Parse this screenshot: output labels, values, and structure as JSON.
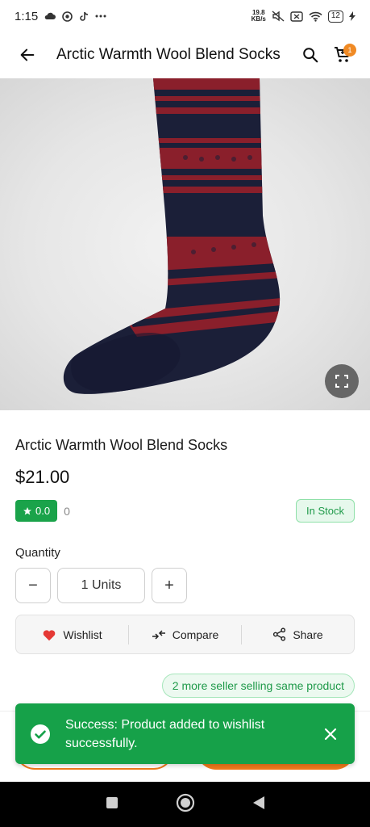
{
  "status_bar": {
    "time": "1:15",
    "net_speed_value": "19.8",
    "net_speed_unit": "KB/s",
    "battery": "12"
  },
  "app_bar": {
    "title": "Arctic Warmth Wool Blend Socks",
    "cart_count": "1"
  },
  "product": {
    "name": "Arctic Warmth Wool Blend Socks",
    "price": "$21.00",
    "rating": "0.0",
    "rating_count": "0",
    "stock_status": "In Stock"
  },
  "quantity": {
    "label": "Quantity",
    "value": "1 Units",
    "minus": "−",
    "plus": "+"
  },
  "actions": {
    "wishlist": "Wishlist",
    "compare": "Compare",
    "share": "Share"
  },
  "sellers": {
    "label": "2 more seller selling same product"
  },
  "toast": {
    "message": "Success: Product added to wishlist successfully."
  },
  "colors": {
    "green": "#16a149",
    "orange": "#f07a1c",
    "heart_red": "#e53935"
  },
  "icons": [
    "back-arrow-icon",
    "search-icon",
    "cart-icon",
    "fullscreen-icon",
    "star-icon",
    "heart-icon",
    "compare-icon",
    "share-icon",
    "check-circle-icon",
    "close-icon"
  ]
}
